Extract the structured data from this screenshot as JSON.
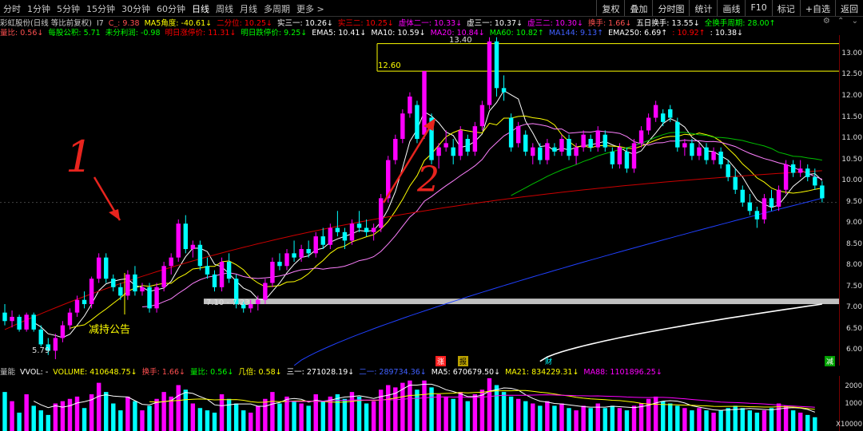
{
  "toolbar": {
    "periods": [
      "分时",
      "1分钟",
      "5分钟",
      "15分钟",
      "30分钟",
      "60分钟",
      "日线",
      "周线",
      "月线",
      "多周期",
      "更多 >"
    ],
    "active_period": "日线",
    "right_buttons": [
      "复权",
      "叠加",
      "分时图",
      "统计",
      "画线",
      "F10",
      "标记",
      "+自选",
      "返回"
    ]
  },
  "info_line1": [
    {
      "t": "彩虹股份(日线 等比前复权)",
      "c": "#cccccc"
    },
    {
      "t": "I7",
      "c": "#cccccc"
    },
    {
      "t": "C_: 9.38",
      "c": "#ff5050"
    },
    {
      "t": "MA5角度: -40.61↓",
      "c": "#ffff00"
    },
    {
      "t": "二分位: 10.25↓",
      "c": "#ff0000"
    },
    {
      "t": "实三一: 10.26↓",
      "c": "#ffffff"
    },
    {
      "t": "实三二: 10.25↓",
      "c": "#ff0000"
    },
    {
      "t": "虚体二一: 10.33↓",
      "c": "#ff00ff"
    },
    {
      "t": "虚三一: 10.37↓",
      "c": "#ffffff"
    },
    {
      "t": "虚三二: 10.30↓",
      "c": "#ff00ff"
    },
    {
      "t": "换手: 1.66↓",
      "c": "#ff5050"
    },
    {
      "t": "五日换手: 13.55↓",
      "c": "#ffffff"
    },
    {
      "t": "全换手周期: 28.00↑",
      "c": "#00ff00"
    }
  ],
  "info_line2": [
    {
      "t": "量比: 0.56↓",
      "c": "#ff5050"
    },
    {
      "t": "每股公积: 5.71",
      "c": "#00ff00"
    },
    {
      "t": "未分利润: -0.98",
      "c": "#00ff00"
    },
    {
      "t": "明日涨停价: 11.31↓",
      "c": "#ff0000"
    },
    {
      "t": "明日跌停价: 9.25↓",
      "c": "#00ff00"
    },
    {
      "t": "EMA5: 10.41↓",
      "c": "#ffffff"
    },
    {
      "t": "MA10: 10.59↓",
      "c": "#ffffff"
    },
    {
      "t": "MA20: 10.84↓",
      "c": "#ff00ff"
    },
    {
      "t": "MA60: 10.82↑",
      "c": "#00ff00"
    },
    {
      "t": "MA144: 9.13↑",
      "c": "#4060ff"
    },
    {
      "t": "EMA250: 6.69↑",
      "c": "#ffffff"
    },
    {
      "t": ": 10.92↑",
      "c": "#ff0000"
    },
    {
      "t": ": 10.38↓",
      "c": "#ffffff"
    }
  ],
  "window_icons": [
    "settings-icon",
    "chevron-up-icon",
    "chevron-down-icon"
  ],
  "price_axis": [
    "13.00",
    "12.50",
    "12.00",
    "11.50",
    "11.00",
    "10.50",
    "10.00",
    "9.50",
    "9.00",
    "8.50",
    "8.00",
    "7.50",
    "7.00",
    "6.50",
    "6.00"
  ],
  "price_range": [
    5.65,
    13.45
  ],
  "annotations": {
    "high_label": "13.40",
    "level_label": "12.60",
    "range_label": "7.10 - 7.23",
    "low_label": "5.79",
    "reduce_holdings": "减持公告",
    "hand_1": "1",
    "hand_2": "2",
    "tag_up": "涨",
    "tag_report": "报",
    "tag_fin": "财",
    "tag_reduce": "减"
  },
  "volume_info": [
    {
      "t": "量能",
      "c": "#cccccc"
    },
    {
      "t": "VVOL: -",
      "c": "#ffffff"
    },
    {
      "t": "VOLUME: 410648.75↓",
      "c": "#ffff00"
    },
    {
      "t": "换手: 1.66↓",
      "c": "#ff5050"
    },
    {
      "t": "量比: 0.56↓",
      "c": "#00ff00"
    },
    {
      "t": "几倍: 0.58↓",
      "c": "#ffff00"
    },
    {
      "t": "三一: 271028.19↓",
      "c": "#ffffff"
    },
    {
      "t": "二一: 289734.36↓",
      "c": "#4060ff"
    },
    {
      "t": "MA5: 670679.50↓",
      "c": "#ffffff"
    },
    {
      "t": "MA21: 834229.31↓",
      "c": "#ffff00"
    },
    {
      "t": "MA88: 1101896.25↓",
      "c": "#ff00ff"
    }
  ],
  "volume_axis": [
    "2000",
    "1000",
    "X10000"
  ],
  "colors": {
    "up": "#ff00ff",
    "down": "#00ffff",
    "bg": "#000000",
    "axis": "#800000"
  },
  "chart_data": {
    "type": "candlestick",
    "ylim": [
      5.65,
      13.45
    ],
    "candles": [
      [
        6.9,
        7.1,
        6.6,
        6.7
      ],
      [
        6.7,
        6.95,
        6.55,
        6.8
      ],
      [
        6.8,
        6.85,
        6.45,
        6.5
      ],
      [
        6.5,
        6.9,
        6.45,
        6.85
      ],
      [
        6.85,
        6.9,
        6.45,
        6.5
      ],
      [
        6.5,
        6.6,
        6.1,
        6.15
      ],
      [
        6.15,
        6.3,
        5.9,
        6.0
      ],
      [
        6.0,
        6.4,
        5.8,
        6.3
      ],
      [
        6.3,
        6.7,
        6.2,
        6.6
      ],
      [
        6.6,
        7.0,
        6.5,
        6.9
      ],
      [
        6.9,
        7.3,
        6.8,
        7.2
      ],
      [
        7.2,
        7.4,
        7.0,
        7.1
      ],
      [
        7.1,
        7.75,
        7.0,
        7.7
      ],
      [
        7.7,
        8.3,
        7.6,
        8.2
      ],
      [
        8.2,
        8.3,
        7.6,
        7.7
      ],
      [
        7.7,
        7.8,
        7.4,
        7.5
      ],
      [
        7.5,
        7.6,
        7.2,
        7.3
      ],
      [
        7.3,
        7.9,
        7.2,
        7.8
      ],
      [
        7.8,
        8.0,
        7.3,
        7.4
      ],
      [
        7.4,
        7.6,
        7.3,
        7.5
      ],
      [
        7.5,
        7.6,
        6.9,
        7.0
      ],
      [
        7.0,
        7.6,
        6.9,
        7.5
      ],
      [
        7.5,
        8.1,
        7.4,
        8.0
      ],
      [
        8.0,
        8.3,
        7.8,
        8.2
      ],
      [
        8.2,
        9.1,
        8.1,
        9.0
      ],
      [
        9.0,
        9.2,
        8.3,
        8.4
      ],
      [
        8.4,
        8.6,
        8.2,
        8.5
      ],
      [
        8.5,
        8.6,
        7.9,
        8.0
      ],
      [
        8.0,
        8.2,
        7.7,
        7.8
      ],
      [
        7.8,
        7.9,
        7.4,
        7.5
      ],
      [
        7.5,
        8.2,
        7.4,
        8.1
      ],
      [
        8.1,
        8.3,
        7.6,
        7.7
      ],
      [
        7.7,
        7.8,
        7.0,
        7.1
      ],
      [
        7.1,
        7.2,
        6.9,
        7.0
      ],
      [
        7.0,
        7.2,
        6.9,
        7.1
      ],
      [
        7.1,
        7.3,
        6.95,
        7.2
      ],
      [
        7.2,
        7.7,
        7.1,
        7.6
      ],
      [
        7.6,
        8.2,
        7.5,
        8.1
      ],
      [
        8.1,
        8.3,
        7.9,
        8.0
      ],
      [
        8.0,
        8.4,
        7.9,
        8.3
      ],
      [
        8.3,
        8.6,
        8.1,
        8.2
      ],
      [
        8.2,
        8.5,
        8.1,
        8.4
      ],
      [
        8.4,
        8.6,
        8.2,
        8.3
      ],
      [
        8.3,
        8.8,
        8.2,
        8.7
      ],
      [
        8.7,
        8.9,
        8.4,
        8.5
      ],
      [
        8.5,
        9.0,
        8.4,
        8.9
      ],
      [
        8.9,
        9.3,
        8.7,
        8.8
      ],
      [
        8.8,
        8.9,
        8.4,
        8.6
      ],
      [
        8.6,
        9.1,
        8.5,
        9.0
      ],
      [
        9.0,
        9.3,
        8.8,
        8.9
      ],
      [
        8.9,
        9.1,
        8.7,
        8.8
      ],
      [
        8.8,
        9.0,
        8.6,
        8.9
      ],
      [
        8.9,
        9.7,
        8.8,
        9.6
      ],
      [
        9.6,
        10.6,
        9.5,
        10.5
      ],
      [
        10.5,
        11.1,
        10.4,
        11.0
      ],
      [
        11.0,
        11.7,
        10.9,
        11.6
      ],
      [
        11.6,
        12.1,
        11.5,
        12.0
      ],
      [
        11.8,
        11.9,
        10.9,
        11.0
      ],
      [
        11.1,
        12.6,
        11.0,
        12.6
      ],
      [
        11.5,
        11.6,
        10.4,
        10.5
      ],
      [
        10.6,
        10.9,
        10.3,
        10.8
      ],
      [
        10.8,
        11.2,
        10.7,
        10.9
      ],
      [
        10.8,
        11.0,
        10.4,
        10.6
      ],
      [
        10.6,
        11.3,
        10.5,
        11.2
      ],
      [
        11.0,
        11.1,
        10.6,
        10.7
      ],
      [
        10.7,
        11.4,
        10.6,
        11.3
      ],
      [
        11.3,
        11.9,
        11.2,
        11.8
      ],
      [
        11.8,
        13.4,
        11.7,
        13.3
      ],
      [
        13.3,
        13.4,
        12.0,
        12.2
      ],
      [
        12.2,
        12.5,
        11.9,
        12.1
      ],
      [
        11.5,
        11.6,
        10.7,
        10.8
      ],
      [
        10.9,
        11.4,
        10.8,
        11.3
      ],
      [
        11.1,
        11.2,
        10.6,
        10.7
      ],
      [
        10.6,
        10.9,
        10.4,
        10.8
      ],
      [
        10.8,
        10.9,
        10.4,
        10.5
      ],
      [
        10.5,
        11.0,
        10.4,
        10.9
      ],
      [
        10.8,
        10.9,
        10.6,
        10.7
      ],
      [
        10.7,
        11.1,
        10.6,
        11.0
      ],
      [
        11.0,
        11.1,
        10.5,
        10.6
      ],
      [
        10.6,
        10.9,
        10.4,
        10.8
      ],
      [
        10.8,
        11.2,
        10.7,
        11.1
      ],
      [
        11.0,
        11.1,
        10.7,
        10.8
      ],
      [
        10.8,
        11.3,
        10.7,
        11.2
      ],
      [
        11.1,
        11.2,
        10.7,
        10.8
      ],
      [
        10.7,
        10.8,
        10.3,
        10.4
      ],
      [
        10.4,
        10.9,
        10.3,
        10.8
      ],
      [
        10.7,
        10.8,
        10.2,
        10.3
      ],
      [
        10.3,
        11.0,
        10.2,
        10.9
      ],
      [
        10.9,
        11.3,
        10.8,
        11.2
      ],
      [
        11.2,
        11.6,
        11.1,
        11.5
      ],
      [
        11.5,
        11.9,
        11.4,
        11.8
      ],
      [
        11.6,
        11.7,
        11.3,
        11.4
      ],
      [
        11.7,
        11.8,
        11.4,
        11.5
      ],
      [
        11.4,
        11.5,
        10.7,
        10.8
      ],
      [
        10.8,
        11.0,
        10.6,
        10.9
      ],
      [
        10.9,
        11.0,
        10.5,
        10.6
      ],
      [
        10.6,
        10.9,
        10.5,
        10.8
      ],
      [
        10.8,
        10.9,
        10.4,
        10.5
      ],
      [
        10.5,
        10.8,
        10.4,
        10.7
      ],
      [
        10.7,
        10.8,
        10.3,
        10.4
      ],
      [
        10.4,
        10.5,
        10.0,
        10.1
      ],
      [
        10.1,
        10.3,
        9.7,
        9.8
      ],
      [
        9.8,
        9.9,
        9.4,
        9.5
      ],
      [
        9.5,
        9.7,
        9.2,
        9.3
      ],
      [
        9.3,
        9.4,
        8.9,
        9.1
      ],
      [
        9.1,
        9.7,
        9.0,
        9.6
      ],
      [
        9.6,
        9.8,
        9.3,
        9.4
      ],
      [
        9.4,
        9.9,
        9.3,
        9.8
      ],
      [
        9.8,
        10.5,
        9.7,
        10.4
      ],
      [
        10.4,
        10.5,
        10.1,
        10.2
      ],
      [
        10.2,
        10.5,
        10.1,
        10.3
      ],
      [
        10.3,
        10.4,
        10.0,
        10.1
      ],
      [
        10.1,
        10.3,
        9.8,
        9.9
      ],
      [
        9.9,
        10.0,
        9.5,
        9.6
      ]
    ],
    "volume": [
      1700,
      1300,
      800,
      1600,
      1100,
      900,
      700,
      1200,
      1300,
      1400,
      1500,
      1000,
      1600,
      2100,
      1700,
      1200,
      900,
      1500,
      1300,
      900,
      1100,
      1400,
      1700,
      1500,
      2000,
      1800,
      1200,
      1000,
      900,
      800,
      1600,
      1400,
      1200,
      900,
      800,
      1100,
      1400,
      1700,
      1200,
      1500,
      1300,
      1200,
      1100,
      1600,
      1300,
      1500,
      1600,
      1400,
      1700,
      1500,
      1200,
      1300,
      1800,
      2000,
      1900,
      2100,
      2200,
      1800,
      2200,
      1900,
      1600,
      1500,
      1400,
      1700,
      1300,
      1600,
      1800,
      2300,
      2000,
      1700,
      1500,
      1400,
      1300,
      1200,
      1100,
      1300,
      1100,
      1200,
      1000,
      900,
      1100,
      1000,
      1200,
      1000,
      1100,
      1000,
      900,
      1100,
      1200,
      1400,
      1500,
      1300,
      1200,
      1100,
      1000,
      900,
      1000,
      900,
      800,
      900,
      1000,
      1100,
      1000,
      900,
      800,
      900,
      1000,
      1200,
      1100,
      900,
      800,
      700,
      600
    ]
  }
}
